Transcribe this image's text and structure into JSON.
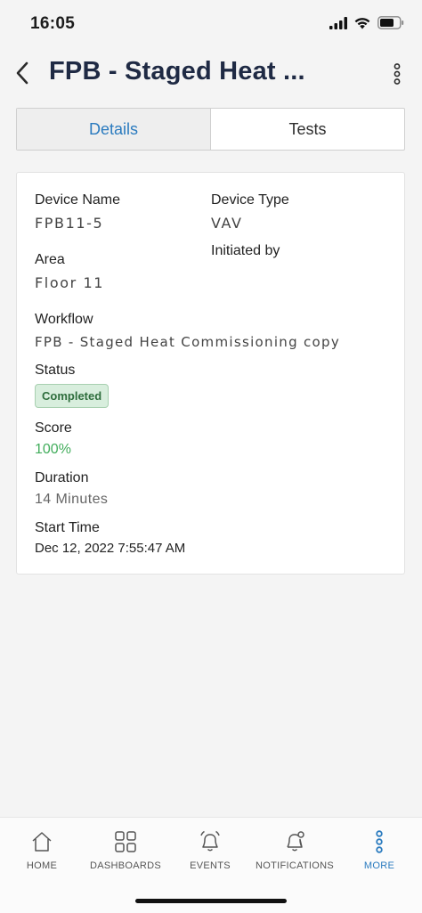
{
  "status_bar": {
    "time": "16:05",
    "icons": [
      "signal-icon",
      "wifi-icon",
      "battery-icon"
    ]
  },
  "header": {
    "title": "FPB - Staged Heat ...",
    "back_icon": "chevron-left-icon",
    "menu_icon": "kebab-menu-icon"
  },
  "tabs": [
    {
      "label": "Details",
      "active": true
    },
    {
      "label": "Tests",
      "active": false
    }
  ],
  "details": {
    "device_name_label": "Device Name",
    "device_name": "FPB11-5",
    "device_type_label": "Device Type",
    "device_type": "VAV",
    "initiated_by_label": "Initiated by",
    "initiated_by": "",
    "area_label": "Area",
    "area": "Floor 11",
    "workflow_label": "Workflow",
    "workflow": "FPB - Staged Heat Commissioning copy",
    "status_label": "Status",
    "status": "Completed",
    "score_label": "Score",
    "score": "100%",
    "duration_label": "Duration",
    "duration": "14 Minutes",
    "start_time_label": "Start Time",
    "start_time": "Dec 12, 2022 7:55:47 AM"
  },
  "colors": {
    "accent": "#2b7bbf",
    "title": "#1f2a44",
    "status_bg": "#d8eedd",
    "status_text": "#2f6e3d",
    "score": "#42ad5c"
  },
  "bottom_nav": [
    {
      "label": "HOME",
      "icon": "home-icon",
      "active": false
    },
    {
      "label": "DASHBOARDS",
      "icon": "dashboard-icon",
      "active": false
    },
    {
      "label": "EVENTS",
      "icon": "bell-icon",
      "active": false
    },
    {
      "label": "NOTIFICATIONS",
      "icon": "notification-bell-icon",
      "active": false
    },
    {
      "label": "MORE",
      "icon": "more-vertical-icon",
      "active": true
    }
  ]
}
